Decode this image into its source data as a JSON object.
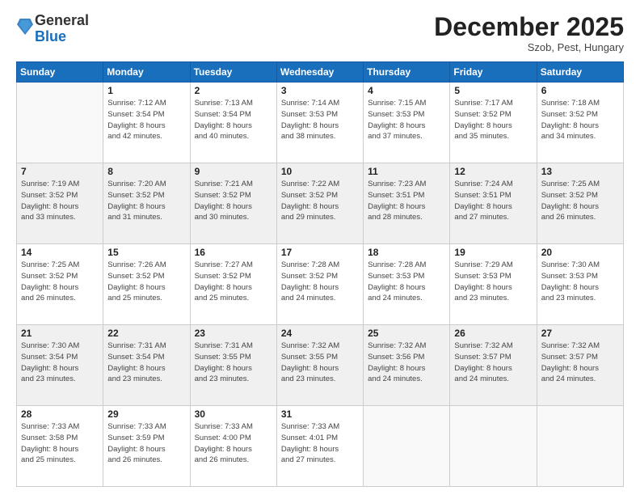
{
  "header": {
    "logo_general": "General",
    "logo_blue": "Blue",
    "month_title": "December 2025",
    "subtitle": "Szob, Pest, Hungary"
  },
  "days_of_week": [
    "Sunday",
    "Monday",
    "Tuesday",
    "Wednesday",
    "Thursday",
    "Friday",
    "Saturday"
  ],
  "weeks": [
    {
      "shaded": false,
      "days": [
        {
          "num": "",
          "info": ""
        },
        {
          "num": "1",
          "info": "Sunrise: 7:12 AM\nSunset: 3:54 PM\nDaylight: 8 hours\nand 42 minutes."
        },
        {
          "num": "2",
          "info": "Sunrise: 7:13 AM\nSunset: 3:54 PM\nDaylight: 8 hours\nand 40 minutes."
        },
        {
          "num": "3",
          "info": "Sunrise: 7:14 AM\nSunset: 3:53 PM\nDaylight: 8 hours\nand 38 minutes."
        },
        {
          "num": "4",
          "info": "Sunrise: 7:15 AM\nSunset: 3:53 PM\nDaylight: 8 hours\nand 37 minutes."
        },
        {
          "num": "5",
          "info": "Sunrise: 7:17 AM\nSunset: 3:52 PM\nDaylight: 8 hours\nand 35 minutes."
        },
        {
          "num": "6",
          "info": "Sunrise: 7:18 AM\nSunset: 3:52 PM\nDaylight: 8 hours\nand 34 minutes."
        }
      ]
    },
    {
      "shaded": true,
      "days": [
        {
          "num": "7",
          "info": "Sunrise: 7:19 AM\nSunset: 3:52 PM\nDaylight: 8 hours\nand 33 minutes."
        },
        {
          "num": "8",
          "info": "Sunrise: 7:20 AM\nSunset: 3:52 PM\nDaylight: 8 hours\nand 31 minutes."
        },
        {
          "num": "9",
          "info": "Sunrise: 7:21 AM\nSunset: 3:52 PM\nDaylight: 8 hours\nand 30 minutes."
        },
        {
          "num": "10",
          "info": "Sunrise: 7:22 AM\nSunset: 3:52 PM\nDaylight: 8 hours\nand 29 minutes."
        },
        {
          "num": "11",
          "info": "Sunrise: 7:23 AM\nSunset: 3:51 PM\nDaylight: 8 hours\nand 28 minutes."
        },
        {
          "num": "12",
          "info": "Sunrise: 7:24 AM\nSunset: 3:51 PM\nDaylight: 8 hours\nand 27 minutes."
        },
        {
          "num": "13",
          "info": "Sunrise: 7:25 AM\nSunset: 3:52 PM\nDaylight: 8 hours\nand 26 minutes."
        }
      ]
    },
    {
      "shaded": false,
      "days": [
        {
          "num": "14",
          "info": "Sunrise: 7:25 AM\nSunset: 3:52 PM\nDaylight: 8 hours\nand 26 minutes."
        },
        {
          "num": "15",
          "info": "Sunrise: 7:26 AM\nSunset: 3:52 PM\nDaylight: 8 hours\nand 25 minutes."
        },
        {
          "num": "16",
          "info": "Sunrise: 7:27 AM\nSunset: 3:52 PM\nDaylight: 8 hours\nand 25 minutes."
        },
        {
          "num": "17",
          "info": "Sunrise: 7:28 AM\nSunset: 3:52 PM\nDaylight: 8 hours\nand 24 minutes."
        },
        {
          "num": "18",
          "info": "Sunrise: 7:28 AM\nSunset: 3:53 PM\nDaylight: 8 hours\nand 24 minutes."
        },
        {
          "num": "19",
          "info": "Sunrise: 7:29 AM\nSunset: 3:53 PM\nDaylight: 8 hours\nand 23 minutes."
        },
        {
          "num": "20",
          "info": "Sunrise: 7:30 AM\nSunset: 3:53 PM\nDaylight: 8 hours\nand 23 minutes."
        }
      ]
    },
    {
      "shaded": true,
      "days": [
        {
          "num": "21",
          "info": "Sunrise: 7:30 AM\nSunset: 3:54 PM\nDaylight: 8 hours\nand 23 minutes."
        },
        {
          "num": "22",
          "info": "Sunrise: 7:31 AM\nSunset: 3:54 PM\nDaylight: 8 hours\nand 23 minutes."
        },
        {
          "num": "23",
          "info": "Sunrise: 7:31 AM\nSunset: 3:55 PM\nDaylight: 8 hours\nand 23 minutes."
        },
        {
          "num": "24",
          "info": "Sunrise: 7:32 AM\nSunset: 3:55 PM\nDaylight: 8 hours\nand 23 minutes."
        },
        {
          "num": "25",
          "info": "Sunrise: 7:32 AM\nSunset: 3:56 PM\nDaylight: 8 hours\nand 24 minutes."
        },
        {
          "num": "26",
          "info": "Sunrise: 7:32 AM\nSunset: 3:57 PM\nDaylight: 8 hours\nand 24 minutes."
        },
        {
          "num": "27",
          "info": "Sunrise: 7:32 AM\nSunset: 3:57 PM\nDaylight: 8 hours\nand 24 minutes."
        }
      ]
    },
    {
      "shaded": false,
      "days": [
        {
          "num": "28",
          "info": "Sunrise: 7:33 AM\nSunset: 3:58 PM\nDaylight: 8 hours\nand 25 minutes."
        },
        {
          "num": "29",
          "info": "Sunrise: 7:33 AM\nSunset: 3:59 PM\nDaylight: 8 hours\nand 26 minutes."
        },
        {
          "num": "30",
          "info": "Sunrise: 7:33 AM\nSunset: 4:00 PM\nDaylight: 8 hours\nand 26 minutes."
        },
        {
          "num": "31",
          "info": "Sunrise: 7:33 AM\nSunset: 4:01 PM\nDaylight: 8 hours\nand 27 minutes."
        },
        {
          "num": "",
          "info": ""
        },
        {
          "num": "",
          "info": ""
        },
        {
          "num": "",
          "info": ""
        }
      ]
    }
  ]
}
